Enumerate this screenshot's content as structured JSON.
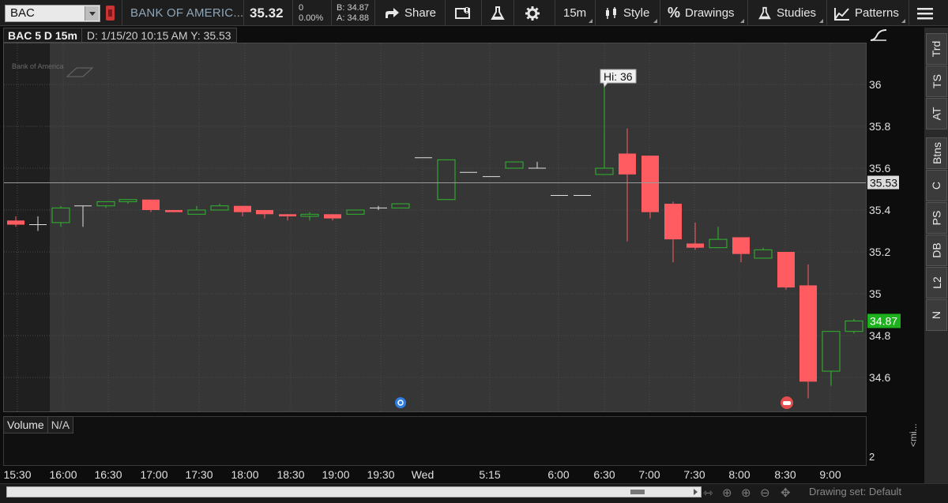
{
  "toolbar": {
    "symbol": "BAC",
    "company": "BANK OF AMERIC...",
    "last": "35.32",
    "net_change": "0",
    "pct_change": "0.00%",
    "bid": "B: 34.87",
    "ask": "A: 34.88",
    "share_label": "Share",
    "interval_label": "15m",
    "style_label": "Style",
    "drawings_label": "Drawings",
    "studies_label": "Studies",
    "patterns_label": "Patterns"
  },
  "info": {
    "study": "BAC 5 D 15m",
    "details": "D: 1/15/20 10:15 AM  Y: 35.53"
  },
  "chart": {
    "watermark": "Bank of America",
    "hi_label": "Hi: 36",
    "crosshair_label": "35.53",
    "last_label": "34.87",
    "colors": {
      "up": "#2eb82e",
      "down": "#ff5c62",
      "grid": "#4a4a4a",
      "last": "#1db21d"
    }
  },
  "chart_data": {
    "type": "candlestick",
    "x_tick_labels": [
      "15:30",
      "16:00",
      "16:30",
      "17:00",
      "17:30",
      "18:00",
      "18:30",
      "19:00",
      "19:30",
      "Wed",
      "5:15",
      "6:00",
      "6:30",
      "7:00",
      "7:30",
      "8:00",
      "8:30",
      "9:00"
    ],
    "y_tick_labels": [
      "36",
      "35.8",
      "35.6",
      "35.4",
      "35.2",
      "35",
      "34.8",
      "34.6"
    ],
    "y_range": [
      34.44,
      36.2
    ],
    "candles": [
      {
        "o": 35.35,
        "h": 35.37,
        "l": 35.32,
        "c": 35.33
      },
      {
        "o": 35.33,
        "h": 35.37,
        "l": 35.3,
        "c": 35.33
      },
      {
        "o": 35.34,
        "h": 35.42,
        "l": 35.32,
        "c": 35.41
      },
      {
        "o": 35.42,
        "h": 35.42,
        "l": 35.32,
        "c": 35.42
      },
      {
        "o": 35.42,
        "h": 35.44,
        "l": 35.41,
        "c": 35.44
      },
      {
        "o": 35.44,
        "h": 35.45,
        "l": 35.43,
        "c": 35.45
      },
      {
        "o": 35.45,
        "h": 35.45,
        "l": 35.39,
        "c": 35.4
      },
      {
        "o": 35.4,
        "h": 35.4,
        "l": 35.39,
        "c": 35.39
      },
      {
        "o": 35.38,
        "h": 35.42,
        "l": 35.38,
        "c": 35.4
      },
      {
        "o": 35.4,
        "h": 35.43,
        "l": 35.4,
        "c": 35.42
      },
      {
        "o": 35.42,
        "h": 35.42,
        "l": 35.37,
        "c": 35.39
      },
      {
        "o": 35.4,
        "h": 35.4,
        "l": 35.36,
        "c": 35.38
      },
      {
        "o": 35.38,
        "h": 35.38,
        "l": 35.35,
        "c": 35.37
      },
      {
        "o": 35.37,
        "h": 35.39,
        "l": 35.35,
        "c": 35.38
      },
      {
        "o": 35.38,
        "h": 35.38,
        "l": 35.35,
        "c": 35.36
      },
      {
        "o": 35.38,
        "h": 35.4,
        "l": 35.38,
        "c": 35.4
      },
      {
        "o": 35.41,
        "h": 35.42,
        "l": 35.4,
        "c": 35.41
      },
      {
        "o": 35.41,
        "h": 35.43,
        "l": 35.41,
        "c": 35.43
      },
      {
        "o": 35.65,
        "h": 35.65,
        "l": 35.65,
        "c": 35.65
      },
      {
        "o": 35.45,
        "h": 35.64,
        "l": 35.45,
        "c": 35.64
      },
      {
        "o": 35.58,
        "h": 35.58,
        "l": 35.58,
        "c": 35.58
      },
      {
        "o": 35.56,
        "h": 35.56,
        "l": 35.56,
        "c": 35.56
      },
      {
        "o": 35.6,
        "h": 35.63,
        "l": 35.6,
        "c": 35.63
      },
      {
        "o": 35.6,
        "h": 35.63,
        "l": 35.6,
        "c": 35.6
      },
      {
        "o": 35.47,
        "h": 35.47,
        "l": 35.47,
        "c": 35.47
      },
      {
        "o": 35.47,
        "h": 35.47,
        "l": 35.47,
        "c": 35.47
      },
      {
        "o": 35.57,
        "h": 36.0,
        "l": 35.57,
        "c": 35.6
      },
      {
        "o": 35.67,
        "h": 35.79,
        "l": 35.25,
        "c": 35.57
      },
      {
        "o": 35.66,
        "h": 35.66,
        "l": 35.36,
        "c": 35.39
      },
      {
        "o": 35.43,
        "h": 35.44,
        "l": 35.15,
        "c": 35.26
      },
      {
        "o": 35.24,
        "h": 35.34,
        "l": 35.21,
        "c": 35.22
      },
      {
        "o": 35.22,
        "h": 35.32,
        "l": 35.22,
        "c": 35.26
      },
      {
        "o": 35.27,
        "h": 35.27,
        "l": 35.15,
        "c": 35.19
      },
      {
        "o": 35.17,
        "h": 35.22,
        "l": 35.17,
        "c": 35.21
      },
      {
        "o": 35.2,
        "h": 35.2,
        "l": 35.02,
        "c": 35.03
      },
      {
        "o": 35.04,
        "h": 35.14,
        "l": 34.5,
        "c": 34.58
      },
      {
        "o": 34.63,
        "h": 34.82,
        "l": 34.56,
        "c": 34.82
      },
      {
        "o": 34.82,
        "h": 34.88,
        "l": 34.81,
        "c": 34.87
      }
    ],
    "volume": {
      "label": "Volume",
      "value_label": "N/A",
      "y_tick_labels": [
        "2"
      ]
    }
  },
  "side_tabs": [
    "Trd",
    "TS",
    "AT",
    "Btns",
    "C",
    "PS",
    "DB",
    "L2",
    "N"
  ],
  "footer": {
    "drawing_set": "Drawing set: Default",
    "minimize": "<mi..."
  }
}
